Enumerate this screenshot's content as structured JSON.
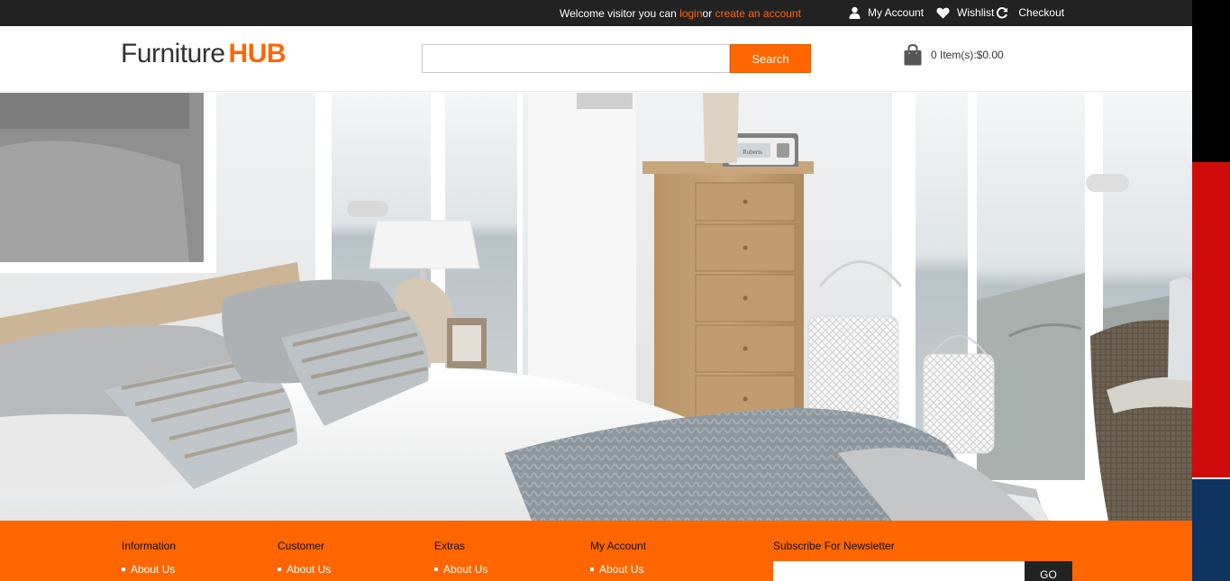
{
  "topbar": {
    "welcome_prefix": "Welcome visitor you can ",
    "login_label": "login",
    "or_text": "or ",
    "create_account_label": "create an account",
    "my_account_label": "My Account",
    "wishlist_label": "Wishlist",
    "checkout_label": "Checkout"
  },
  "header": {
    "logo_main": "Furniture",
    "logo_accent": "HUB",
    "search_placeholder": "",
    "search_button": "Search",
    "cart_summary": "0 Item(s):$0.00"
  },
  "hero": {
    "radio_brand": "Roberts"
  },
  "footer": {
    "columns": [
      {
        "title": "Information",
        "link": "About Us"
      },
      {
        "title": "Customer",
        "link": "About Us"
      },
      {
        "title": "Extras",
        "link": "About Us"
      },
      {
        "title": "My Account",
        "link": "About Us"
      }
    ],
    "newsletter_title": "Subscribe For Newsletter",
    "newsletter_button": "GO"
  },
  "colors": {
    "accent": "#ff6600",
    "topbar_bg": "#222222",
    "footer_bg": "#ff6600"
  },
  "icons": [
    "user-icon",
    "heart-icon",
    "refresh-icon",
    "shopping-bag-icon"
  ]
}
